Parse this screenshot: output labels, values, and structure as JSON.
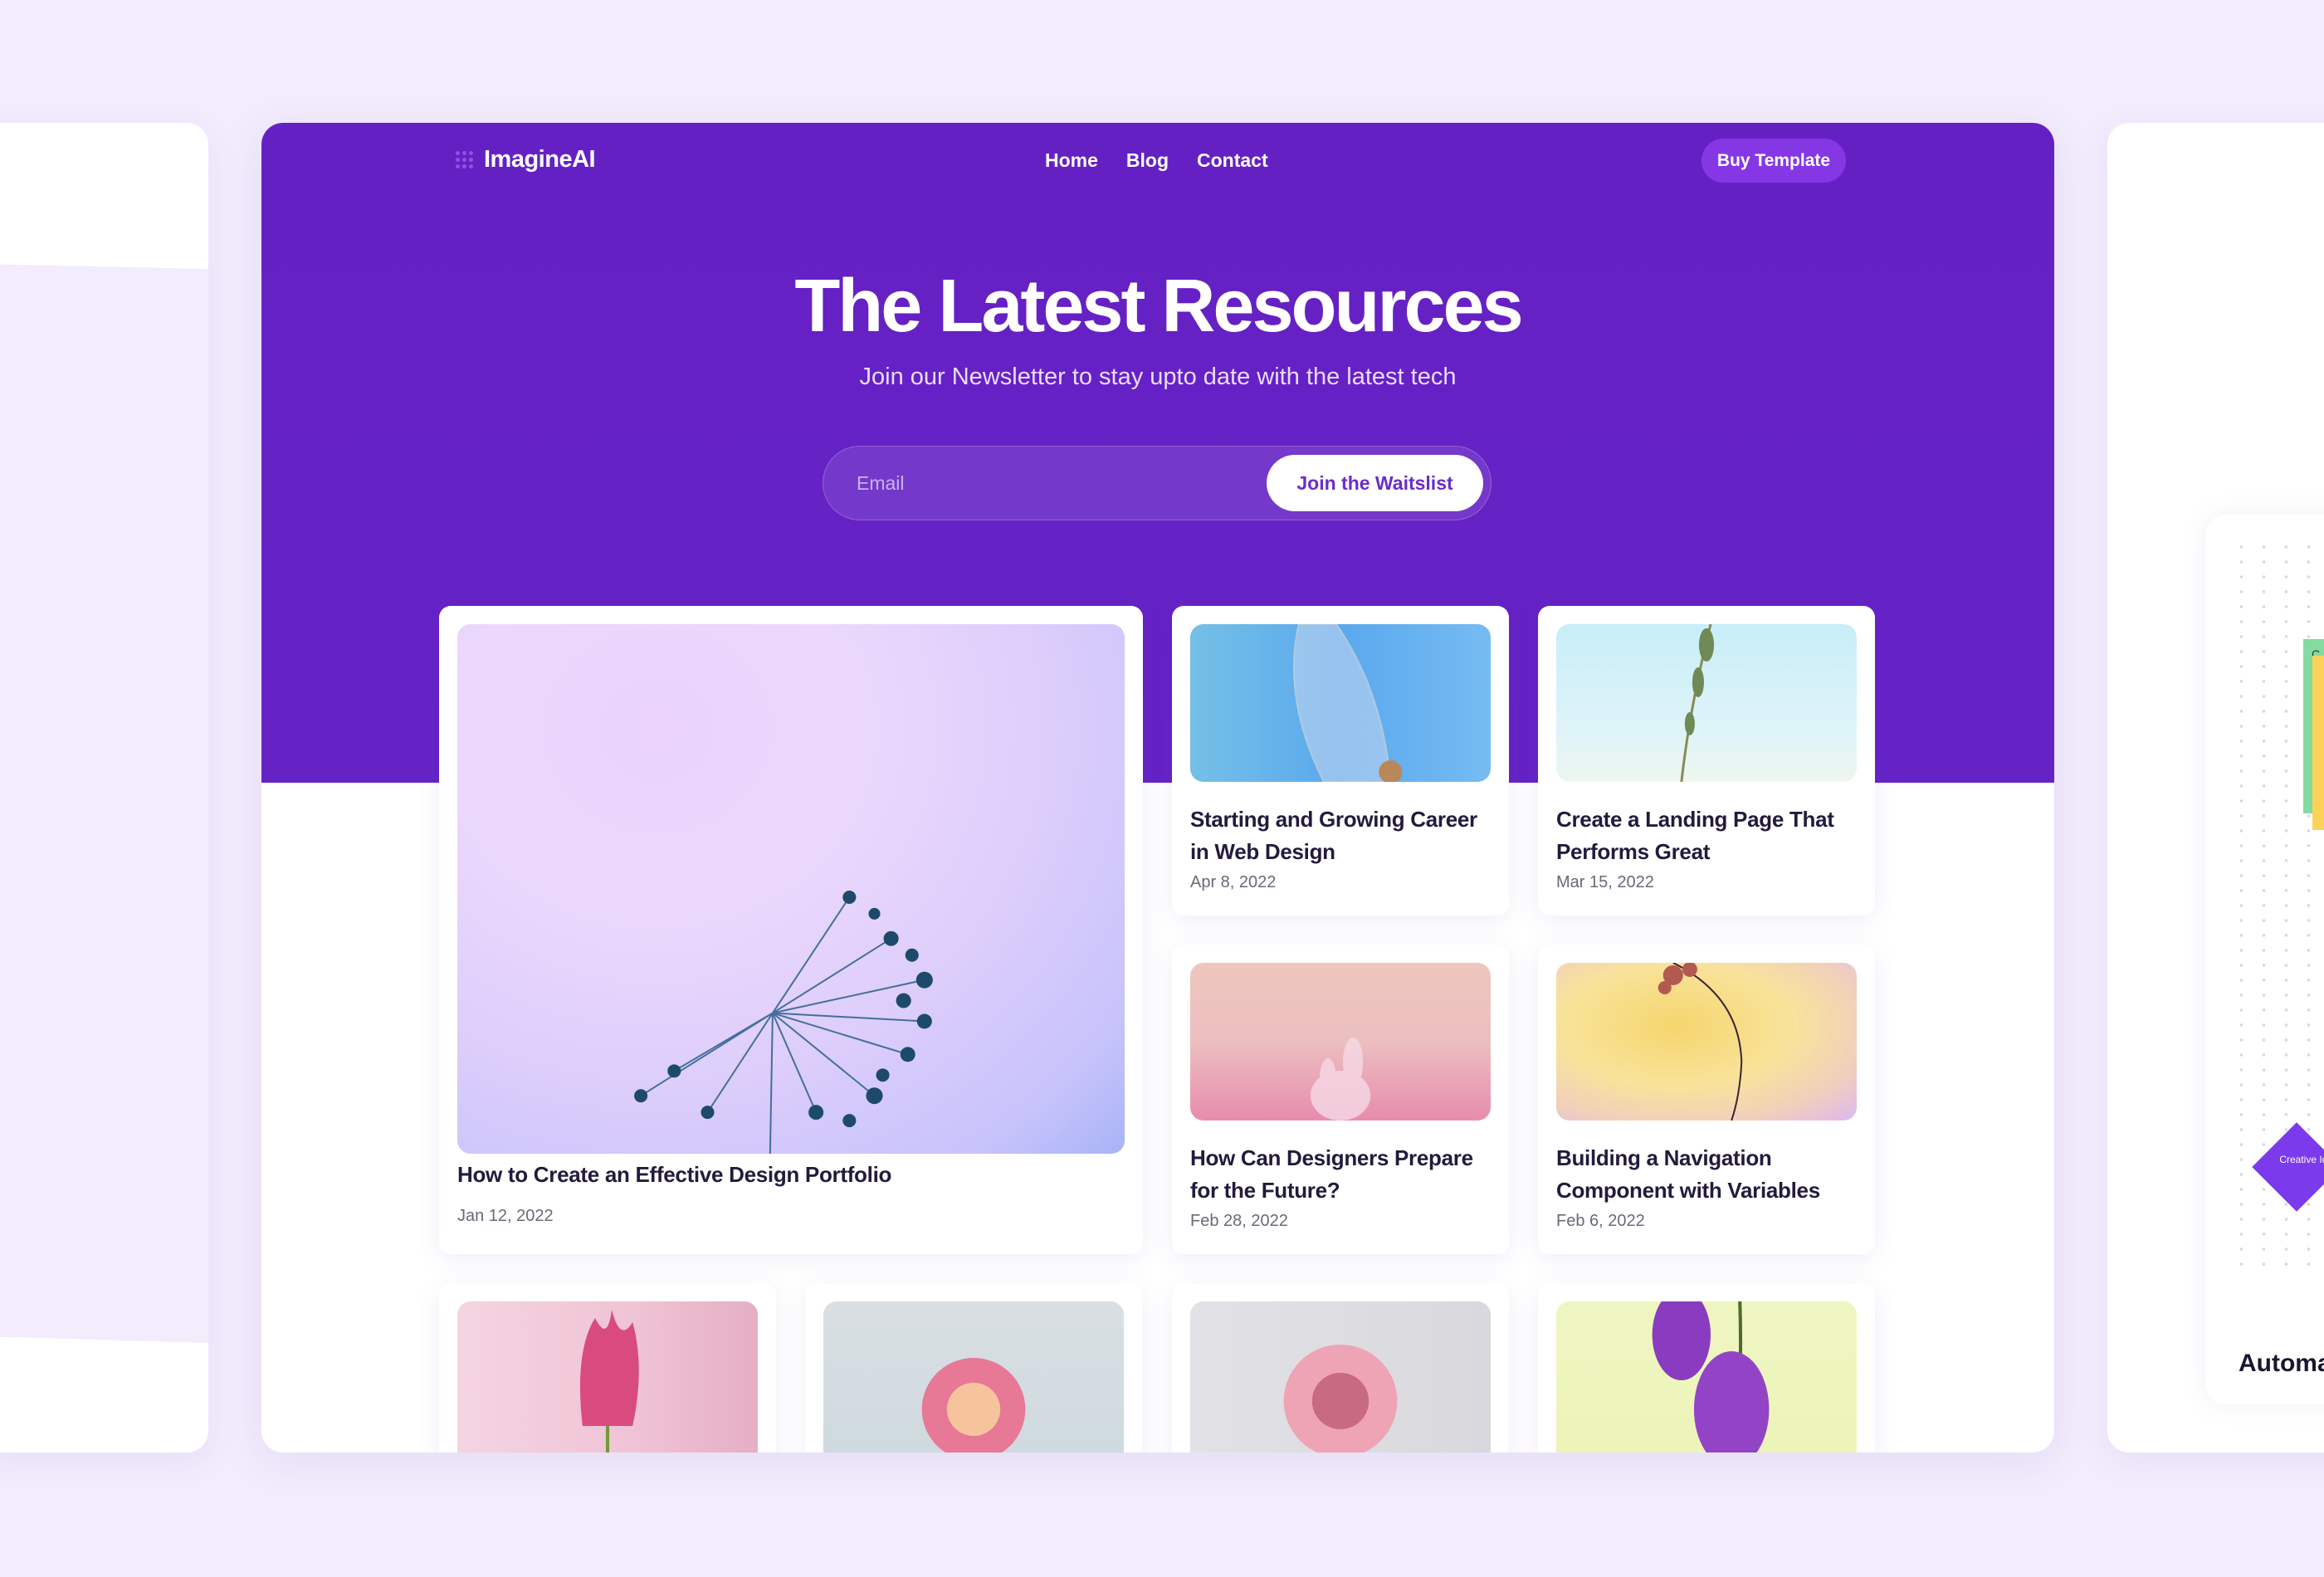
{
  "brand": {
    "name": "ImagineAI",
    "accent": "#6520c4",
    "button_bg": "#8537e6"
  },
  "nav": {
    "links": [
      "Home",
      "Blog",
      "Contact"
    ],
    "cta": "Buy Template"
  },
  "hero": {
    "title": "The Latest Resources",
    "subtitle": "Join our Newsletter to stay upto date with the latest tech",
    "email_placeholder": "Email",
    "email_value": "",
    "submit_label": "Join the Waitslist"
  },
  "posts": [
    {
      "title": "How to Create an Effective Design Portfolio",
      "date": "Jan 12, 2022",
      "image": "blue-allium-flower"
    },
    {
      "title": "Starting and Growing Career in Web Design",
      "date": "Apr 8, 2022",
      "image": "skeleton-leaf"
    },
    {
      "title": "Create a Landing Page That Performs Great",
      "date": "Mar 15, 2022",
      "image": "grass-stem"
    },
    {
      "title": "How Can Designers Prepare for the Future?",
      "date": "Feb 28, 2022",
      "image": "pink-fern"
    },
    {
      "title": "Building a Navigation Component with Variables",
      "date": "Feb 6, 2022",
      "image": "dried-flower-yellow"
    },
    {
      "title": "",
      "date": "",
      "image": "pink-tulip"
    },
    {
      "title": "",
      "date": "",
      "image": "pink-dahlia"
    },
    {
      "title": "",
      "date": "",
      "image": "pink-rose"
    },
    {
      "title": "",
      "date": "",
      "image": "purple-orchid"
    }
  ],
  "side_preview": {
    "diamond_label": "Creative Idea",
    "sticky_letter": "C",
    "heading_partial": "Automa"
  }
}
